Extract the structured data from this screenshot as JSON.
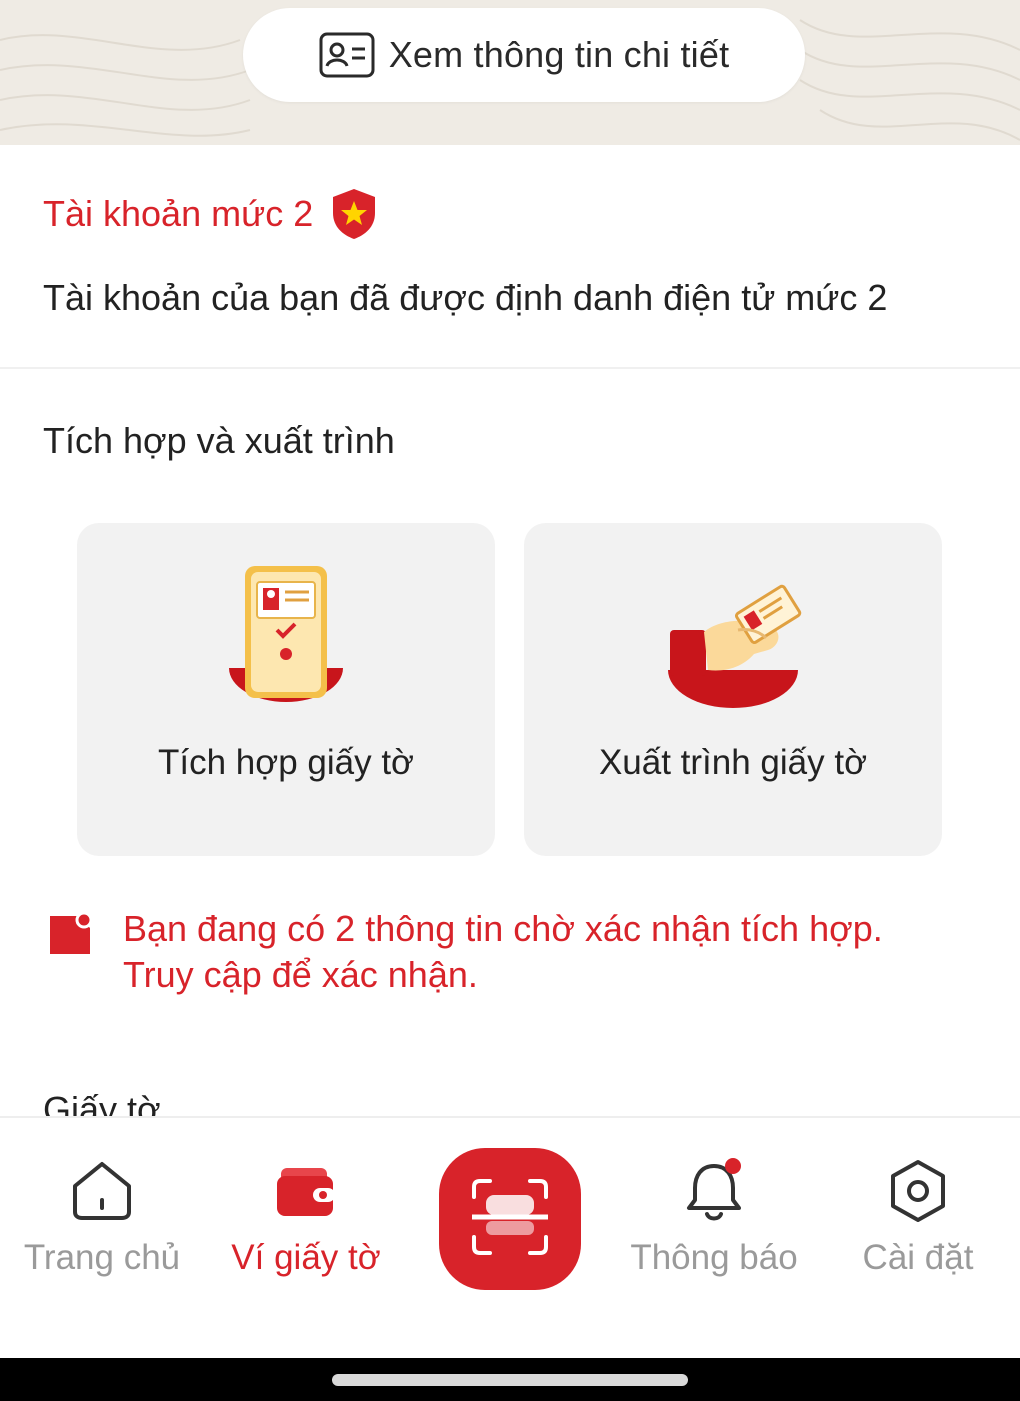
{
  "header": {
    "detail_button_label": "Xem thông tin chi tiết",
    "detail_icon": "id-card-icon"
  },
  "account": {
    "level_title": "Tài khoản mức 2",
    "level_icon": "shield-star-icon",
    "description": "Tài khoản của bạn đã được định danh điện tử mức 2"
  },
  "integration": {
    "section_title": "Tích hợp và xuất trình",
    "cards": [
      {
        "label": "Tích hợp giấy tờ",
        "icon": "phone-document-icon"
      },
      {
        "label": "Xuất trình giấy tờ",
        "icon": "hand-card-icon"
      }
    ]
  },
  "pending_notice": {
    "icon": "note-badge-icon",
    "line1": "Bạn đang có 2 thông tin chờ xác nhận tích hợp.",
    "line2": "Truy cập để xác nhận."
  },
  "documents": {
    "section_title": "Giấy tờ"
  },
  "bottom_nav": {
    "items": [
      {
        "label": "Trang chủ",
        "icon": "home-icon",
        "active": false
      },
      {
        "label": "Ví giấy tờ",
        "icon": "wallet-icon",
        "active": true
      },
      {
        "label": "",
        "icon": "scan-icon",
        "active": false
      },
      {
        "label": "Thông báo",
        "icon": "bell-icon",
        "active": false,
        "badge": true
      },
      {
        "label": "Cài đặt",
        "icon": "settings-icon",
        "active": false
      }
    ]
  },
  "colors": {
    "accent": "#d8232a",
    "banner_bg": "#efebe4",
    "card_bg": "#f2f2f2",
    "inactive": "#9a9a9a"
  }
}
